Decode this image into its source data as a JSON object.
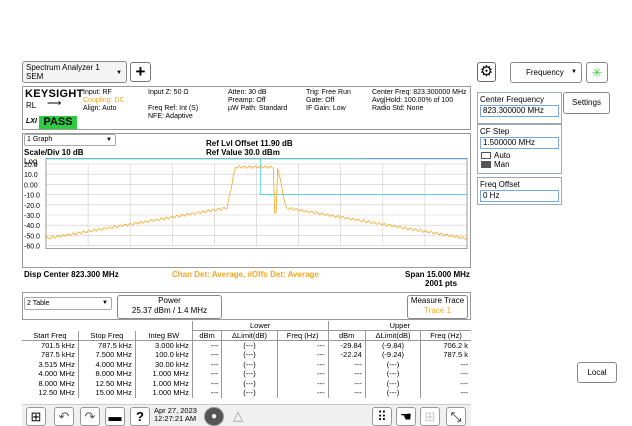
{
  "app": {
    "window_title_line1": "Spectrum Analyzer 1",
    "window_title_line2": "SEM"
  },
  "header": {
    "logo": "KEYSIGHT",
    "rl_label": "RL",
    "lxi": "LXI",
    "status": "PASS",
    "col1": [
      "Input: RF",
      "Coupling: DC",
      "Align: Auto"
    ],
    "col2": [
      "Input Z: 50 Ω",
      "",
      "Freq Ref: Int (S)",
      "NFE: Adaptive"
    ],
    "col3": [
      "Atten: 30 dB",
      "Preamp: Off",
      "µW Path: Standard"
    ],
    "col4": [
      "Trig: Free Run",
      "Gate: Off",
      "IF Gain: Low"
    ],
    "col5": [
      "Center Freq: 823.300000 MHz",
      "Avg|Hold: 100.00% of 100",
      "Radio Std: None"
    ]
  },
  "graph": {
    "selector": "1 Graph",
    "scale": "Scale/Div 10 dB",
    "log": "Log",
    "ref_offset": "Ref Lvl Offset 11.90 dB",
    "ref_value": "Ref Value 30.0 dBm",
    "y_ticks": [
      "20.0",
      "10.0",
      "0.00",
      "-10.0",
      "-20.0",
      "-30.0",
      "-40.0",
      "-50.0",
      "-60.0"
    ],
    "disp_center": "Disp Center 823.300 MHz",
    "detector": "Chan Det: Average, #Offs Det: Average",
    "span": "Span 15.000 MHz",
    "points": "2001 pts"
  },
  "table": {
    "selector": "2 Table",
    "power_label": "Power",
    "power_value": "25.37 dBm / 1.4 MHz",
    "measure_trace_label": "Measure Trace",
    "measure_trace_value": "Trace 1",
    "group_lower": "Lower",
    "group_upper": "Upper",
    "columns": [
      "Start Freq",
      "Stop Freq",
      "Integ BW",
      "dBm",
      "ΔLimit(dB)",
      "Freq (Hz)",
      "dBm",
      "ΔLimit(dB)",
      "Freq (Hz)"
    ],
    "rows": [
      [
        "701.5 kHz",
        "787.5 kHz",
        "3.000 kHz",
        "---",
        "(---)",
        "---",
        "-29.84",
        "(-9.84)",
        "706.2 k"
      ],
      [
        "787.5 kHz",
        "7.500 MHz",
        "100.0 kHz",
        "---",
        "(---)",
        "---",
        "-22.24",
        "(-9.24)",
        "787.5 k"
      ],
      [
        "3.515 MHz",
        "4.000 MHz",
        "30.00 kHz",
        "---",
        "(---)",
        "---",
        "---",
        "(---)",
        "---"
      ],
      [
        "4.000 MHz",
        "8.000 MHz",
        "1.000 MHz",
        "---",
        "(---)",
        "---",
        "---",
        "(---)",
        "---"
      ],
      [
        "8.000 MHz",
        "12.50 MHz",
        "1.000 MHz",
        "---",
        "(---)",
        "---",
        "---",
        "(---)",
        "---"
      ],
      [
        "12.50 MHz",
        "15.00 MHz",
        "1.000 MHz",
        "---",
        "(---)",
        "---",
        "---",
        "(---)",
        "---"
      ]
    ]
  },
  "right_panel": {
    "frequency_menu": "Frequency",
    "settings": "Settings",
    "center_freq_label": "Center Frequency",
    "center_freq_value": "823.300000 MHz",
    "cf_step_label": "CF Step",
    "cf_step_value": "1.500000 MHz",
    "auto": "Auto",
    "man": "Man",
    "freq_offset_label": "Freq Offset",
    "freq_offset_value": "0 Hz",
    "local": "Local"
  },
  "taskbar": {
    "date": "Apr 27, 2023",
    "time": "12:27:21 AM"
  },
  "colors": {
    "trace": "#f5a623",
    "limit_upper": "#cc44cc",
    "limit_cyan": "#4dd0e1",
    "pass": "#2ecc40"
  }
}
